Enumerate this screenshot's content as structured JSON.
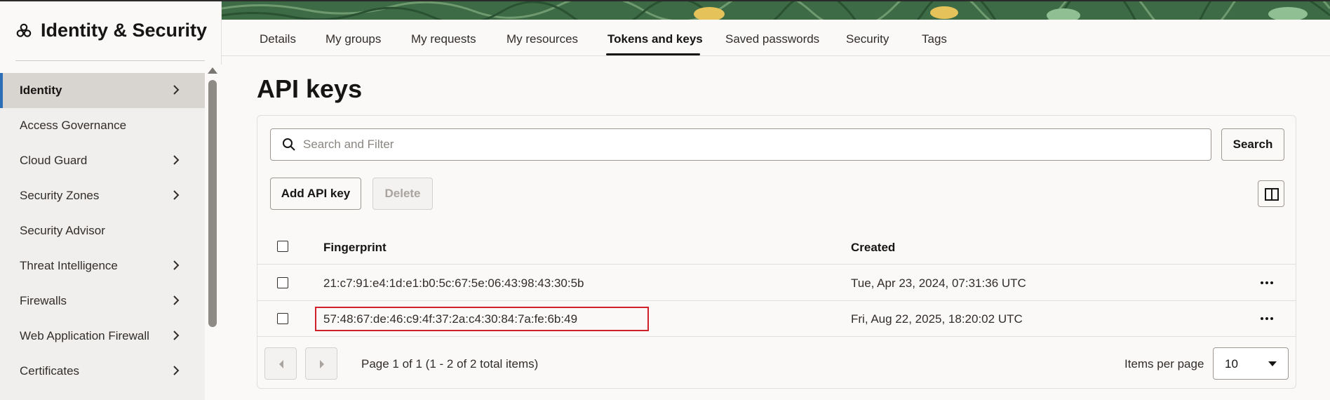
{
  "app": {
    "title": "Identity & Security"
  },
  "sidebar": {
    "items": [
      {
        "label": "Identity",
        "has_chevron": true,
        "active": true
      },
      {
        "label": "Access Governance",
        "has_chevron": false
      },
      {
        "label": "Cloud Guard",
        "has_chevron": true
      },
      {
        "label": "Security Zones",
        "has_chevron": true
      },
      {
        "label": "Security Advisor",
        "has_chevron": false
      },
      {
        "label": "Threat Intelligence",
        "has_chevron": true
      },
      {
        "label": "Firewalls",
        "has_chevron": true
      },
      {
        "label": "Web Application Firewall",
        "has_chevron": true
      },
      {
        "label": "Certificates",
        "has_chevron": true
      }
    ]
  },
  "tabs": [
    {
      "label": "Details"
    },
    {
      "label": "My groups"
    },
    {
      "label": "My requests"
    },
    {
      "label": "My resources"
    },
    {
      "label": "Tokens and keys",
      "active": true
    },
    {
      "label": "Saved passwords"
    },
    {
      "label": "Security"
    },
    {
      "label": "Tags"
    }
  ],
  "main": {
    "title": "API keys",
    "search": {
      "placeholder": "Search and Filter",
      "value": "",
      "button_label": "Search"
    },
    "actions": {
      "add_label": "Add API key",
      "delete_label": "Delete"
    },
    "table": {
      "headers": {
        "fingerprint": "Fingerprint",
        "created": "Created"
      },
      "rows": [
        {
          "fingerprint": "21:c7:91:e4:1d:e1:b0:5c:67:5e:06:43:98:43:30:5b",
          "created": "Tue, Apr 23, 2024, 07:31:36 UTC"
        },
        {
          "fingerprint": "57:48:67:de:46:c9:4f:37:2a:c4:30:84:7a:fe:6b:49",
          "created": "Fri, Aug 22, 2025, 18:20:02 UTC",
          "highlighted": true
        }
      ]
    },
    "pagination": {
      "status": "Page 1 of 1 (1 - 2 of 2 total items)",
      "items_per_page_label": "Items per page",
      "items_per_page_value": "10"
    }
  },
  "colors": {
    "accent": "#2c6fb7",
    "highlight": "#d0202a",
    "banner": "#3d6b45"
  }
}
